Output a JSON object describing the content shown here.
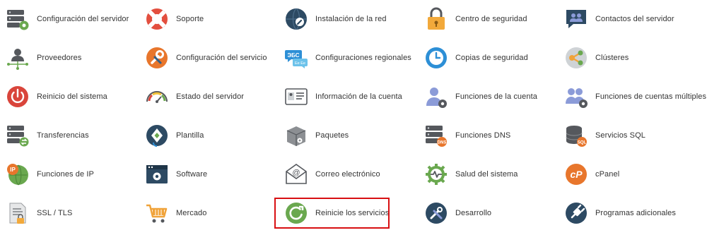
{
  "colors": {
    "highlight_border": "#d80f12",
    "text": "#333333"
  },
  "columns": [
    [
      {
        "name": "configuracion-del-servidor",
        "label": "Configuración del servidor",
        "icon": "server-gear-icon"
      },
      {
        "name": "proveedores",
        "label": "Proveedores",
        "icon": "provider-network-icon"
      },
      {
        "name": "reinicio-del-sistema",
        "label": "Reinicio del sistema",
        "icon": "power-icon"
      },
      {
        "name": "transferencias",
        "label": "Transferencias",
        "icon": "server-transfer-icon"
      },
      {
        "name": "funciones-de-ip",
        "label": "Funciones de IP",
        "icon": "ip-globe-icon"
      },
      {
        "name": "ssl-tls",
        "label": "SSL / TLS",
        "icon": "certificate-lock-icon"
      }
    ],
    [
      {
        "name": "soporte",
        "label": "Soporte",
        "icon": "lifebuoy-icon"
      },
      {
        "name": "configuracion-del-servicio",
        "label": "Configuración del servicio",
        "icon": "wrench-icon"
      },
      {
        "name": "estado-del-servidor",
        "label": "Estado del servidor",
        "icon": "gauge-icon"
      },
      {
        "name": "plantilla",
        "label": "Plantilla",
        "icon": "theme-brush-icon"
      },
      {
        "name": "software",
        "label": "Software",
        "icon": "software-window-icon"
      },
      {
        "name": "mercado",
        "label": "Mercado",
        "icon": "shopping-cart-icon"
      }
    ],
    [
      {
        "name": "instalacion-de-la-red",
        "label": "Instalación de la red",
        "icon": "network-globe-wrench-icon"
      },
      {
        "name": "configuraciones-regionales",
        "label": "Configuraciones regionales",
        "icon": "language-bubbles-icon"
      },
      {
        "name": "informacion-de-la-cuenta",
        "label": "Información de la cuenta",
        "icon": "id-card-icon"
      },
      {
        "name": "paquetes",
        "label": "Paquetes",
        "icon": "package-box-icon"
      },
      {
        "name": "correo-electronico",
        "label": "Correo electrónico",
        "icon": "email-envelope-icon"
      },
      {
        "name": "reinicie-los-servicios",
        "label": "Reinicie los servicios",
        "icon": "restart-icon"
      }
    ],
    [
      {
        "name": "centro-de-seguridad",
        "label": "Centro de seguridad",
        "icon": "padlock-icon"
      },
      {
        "name": "copias-de-seguridad",
        "label": "Copias de seguridad",
        "icon": "backup-clock-icon"
      },
      {
        "name": "funciones-de-la-cuenta",
        "label": "Funciones de la cuenta",
        "icon": "user-gear-icon"
      },
      {
        "name": "funciones-dns",
        "label": "Funciones DNS",
        "icon": "server-dns-icon"
      },
      {
        "name": "salud-del-sistema",
        "label": "Salud del sistema",
        "icon": "health-gear-icon"
      },
      {
        "name": "desarrollo",
        "label": "Desarrollo",
        "icon": "developer-tools-icon"
      }
    ],
    [
      {
        "name": "contactos-del-servidor",
        "label": "Contactos del servidor",
        "icon": "contacts-chat-icon"
      },
      {
        "name": "clusteres",
        "label": "Clústeres",
        "icon": "cluster-share-icon"
      },
      {
        "name": "funciones-de-cuentas-multiples",
        "label": "Funciones de cuentas múltiples",
        "icon": "multi-user-gear-icon"
      },
      {
        "name": "servicios-sql",
        "label": "Servicios SQL",
        "icon": "sql-database-icon"
      },
      {
        "name": "cpanel",
        "label": "cPanel",
        "icon": "cpanel-logo-icon"
      },
      {
        "name": "programas-adicionales",
        "label": "Programas adicionales",
        "icon": "plugin-icon"
      }
    ]
  ],
  "icon_text": {
    "dns": "DNS",
    "sql": "SQL",
    "ip": "IP",
    "cpanel": "cP",
    "at": "@",
    "lang_top": "ЭБС",
    "lang_bottom": "Ee Ee"
  }
}
